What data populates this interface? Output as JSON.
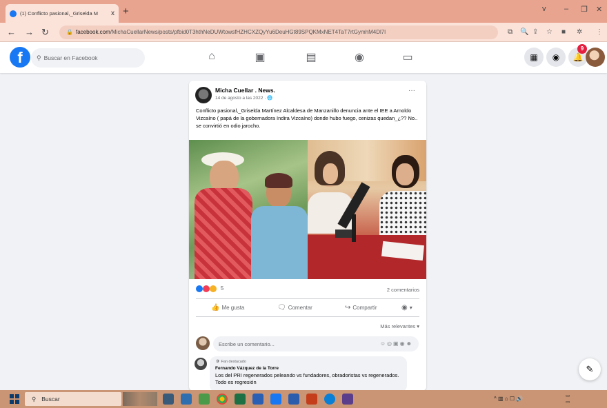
{
  "browser": {
    "tab_title": "(1) Conflicto pasional,_Griselda M",
    "tab_close": "x",
    "new_tab": "+",
    "url_host": "facebook.com",
    "url_path": "/MichaCuellarNews/posts/pfbid0T3hthNeDUWtowsfHZHCXZQyYu6DeuHGt89SPQKMxNET4TaT7rtGymhM4Dl7l",
    "window_controls": [
      "v",
      "–",
      "❐",
      "✕"
    ]
  },
  "facebook": {
    "search_placeholder": "Buscar en Facebook",
    "notifications_badge": "9"
  },
  "post": {
    "author": "Micha Cuellar . News.",
    "date": "14 de agosto a las 2022 · ",
    "text": "Conflicto pasional,_Griselda Martínez Alcaldesa de Manzanillo denuncia ante el IEE a Arnoldo Vizcaíno ( papá de la gobernadora Indira Vizcaíno) donde hubo fuego, cenizas quedan_¿?? No.. se convirtió en odio jarocho.",
    "more_label": "···",
    "reaction_count": "5",
    "comments_label": "2 comentarios",
    "actions": {
      "like": "Me gusta",
      "comment": "Comentar",
      "share": "Compartir"
    },
    "sort_label": "Más relevantes ▾",
    "comment_placeholder": "Escribe un comentario...",
    "comment": {
      "fan_label": "Fan destacado",
      "name": "Fernando Vázquez de la Torre",
      "text": "Los del PRI regenerados peleando vs fundadores, obradoristas vs regenerados. Todo es regresión"
    }
  },
  "taskbar": {
    "search_label": "Buscar"
  },
  "colors": {
    "facebook_blue": "#1877f2",
    "tab_bar": "#e9a48f",
    "taskbar": "#c99575",
    "badge_red": "#e41e3f"
  }
}
